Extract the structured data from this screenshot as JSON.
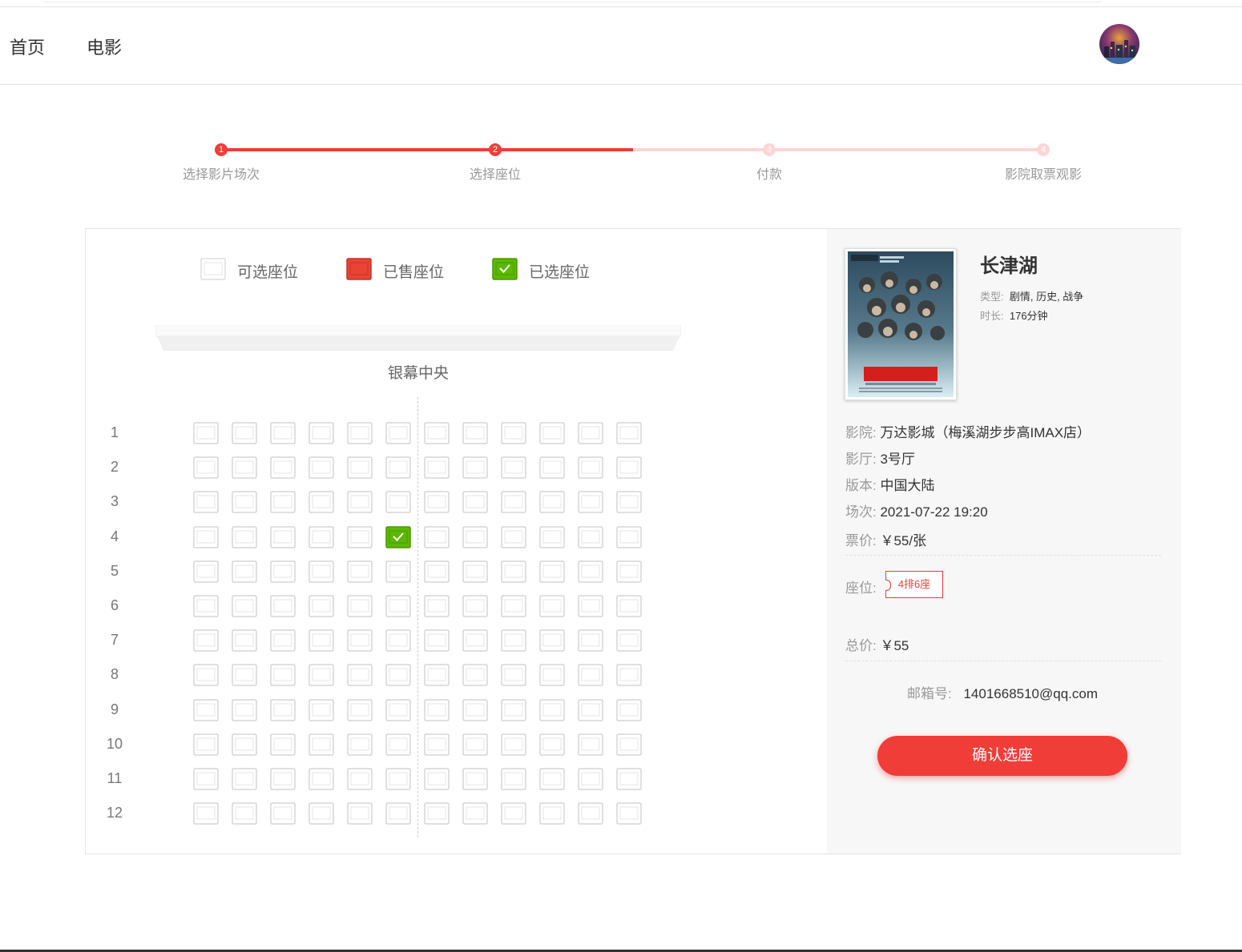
{
  "nav": {
    "items": [
      {
        "label": "首页"
      },
      {
        "label": "电影"
      }
    ]
  },
  "steps": {
    "current": 2,
    "items": [
      {
        "num": "1",
        "label": "选择影片场次"
      },
      {
        "num": "2",
        "label": "选择座位"
      },
      {
        "num": "3",
        "label": "付款"
      },
      {
        "num": "4",
        "label": "影院取票观影"
      }
    ]
  },
  "legend": {
    "available": "可选座位",
    "sold": "已售座位",
    "selected": "已选座位"
  },
  "screen_label": "银幕中央",
  "seat_map": {
    "rows": [
      "1",
      "2",
      "3",
      "4",
      "5",
      "6",
      "7",
      "8",
      "9",
      "10",
      "11",
      "12"
    ],
    "cols": 12,
    "selected": [
      {
        "row": 4,
        "col": 6
      }
    ]
  },
  "movie": {
    "title": "长津湖",
    "genre_label": "类型:",
    "genre": "剧情, 历史, 战争",
    "duration_label": "时长:",
    "duration": "176分钟"
  },
  "details": {
    "cinema_label": "影院:",
    "cinema": "万达影城（梅溪湖步步高IMAX店）",
    "hall_label": "影厅:",
    "hall": "3号厅",
    "version_label": "版本:",
    "version": "中国大陆",
    "session_label": "场次:",
    "session": "2021-07-22 19:20",
    "price_label": "票价:",
    "price": "￥55/张",
    "seat_label": "座位:",
    "seat_tag": "4排6座",
    "total_label": "总价:",
    "total": "￥55",
    "email_label": "邮箱号:",
    "email": "1401668510@qq.com"
  },
  "confirm_button": "确认选座",
  "colors": {
    "accent": "#f03d37",
    "accent_light": "#fdd5d4",
    "seat_selected": "#5cb800",
    "seat_sold": "#e94335"
  }
}
